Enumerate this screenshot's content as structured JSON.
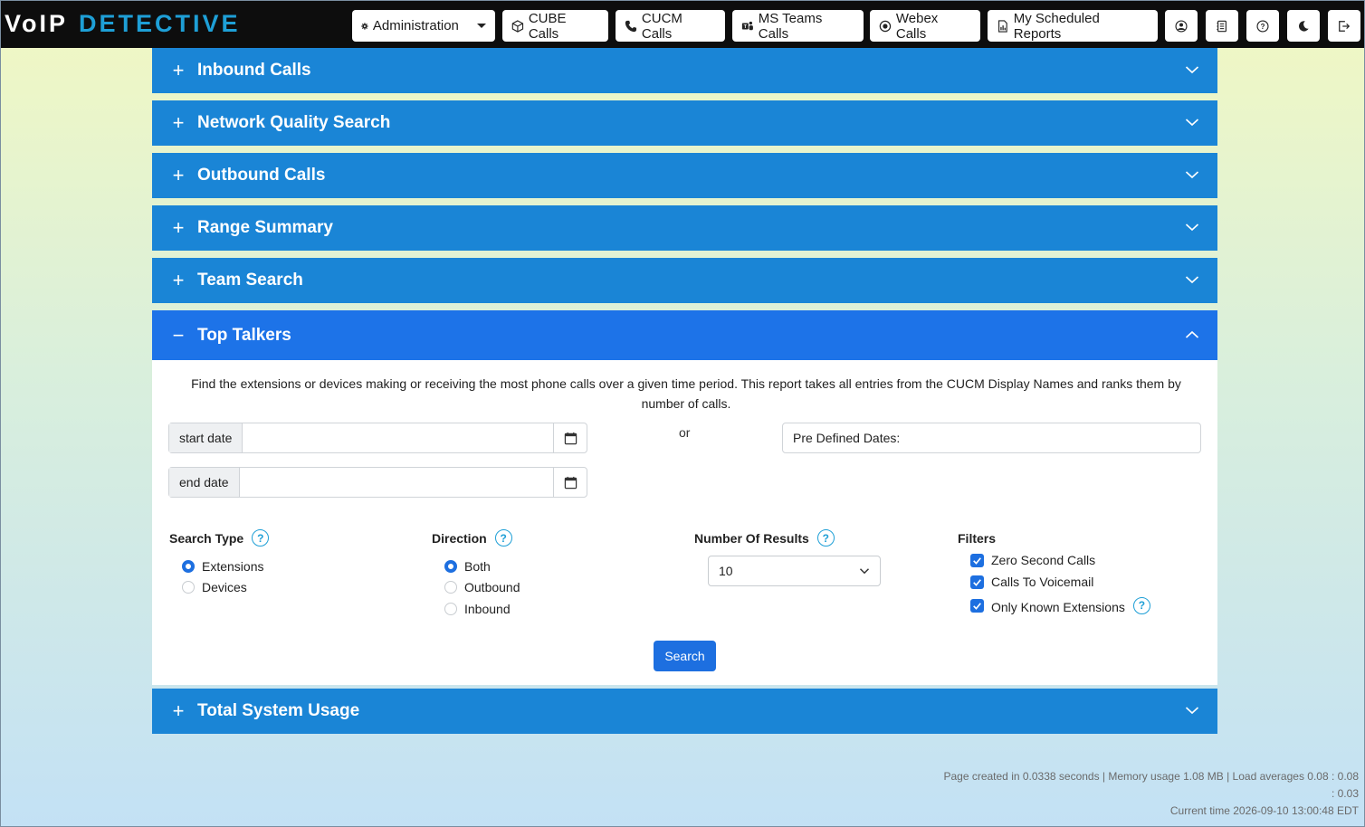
{
  "brand": {
    "logo_part1": "VoIP",
    "logo_part2": "DETECTIVE"
  },
  "nav": {
    "administration": "Administration",
    "cube_calls": "CUBE Calls",
    "cucm_calls": "CUCM Calls",
    "ms_teams_calls": "MS Teams Calls",
    "webex_calls": "Webex Calls",
    "scheduled_reports": "My Scheduled Reports"
  },
  "sections": {
    "inbound_calls": "Inbound Calls",
    "network_quality": "Network Quality Search",
    "outbound_calls": "Outbound Calls",
    "range_summary": "Range Summary",
    "team_search": "Team Search",
    "top_talkers": "Top Talkers",
    "total_system_usage": "Total System Usage"
  },
  "top_talkers": {
    "description": "Find the extensions or devices making or receiving the most phone calls over a given time period. This report takes all entries from the CUCM Display Names and ranks them by number of calls.",
    "start_date_label": "start date",
    "start_date_value": "",
    "end_date_label": "end date",
    "end_date_value": "",
    "or": "or",
    "predefined_dates": "Pre Defined Dates:",
    "search_type": {
      "label": "Search Type",
      "options": [
        "Extensions",
        "Devices"
      ],
      "selected": "Extensions"
    },
    "direction": {
      "label": "Direction",
      "options": [
        "Both",
        "Outbound",
        "Inbound"
      ],
      "selected": "Both"
    },
    "number_of_results": {
      "label": "Number Of Results",
      "value": "10"
    },
    "filters": {
      "label": "Filters",
      "items": [
        {
          "label": "Zero Second Calls",
          "checked": true
        },
        {
          "label": "Calls To Voicemail",
          "checked": true
        },
        {
          "label": "Only Known Extensions",
          "checked": true
        }
      ]
    },
    "search_button": "Search"
  },
  "footer": {
    "line1": "Page created in 0.0338 seconds | Memory usage 1.08 MB | Load averages 0.08 : 0.08",
    "line2": ": 0.03",
    "line3": "Current time 2026-09-10 13:00:48 EDT"
  },
  "colors": {
    "accordion": "#1a85d6",
    "accordion_active": "#1d73e8",
    "primary": "#1d6fe0",
    "logo_accent": "#1e9fd6"
  }
}
